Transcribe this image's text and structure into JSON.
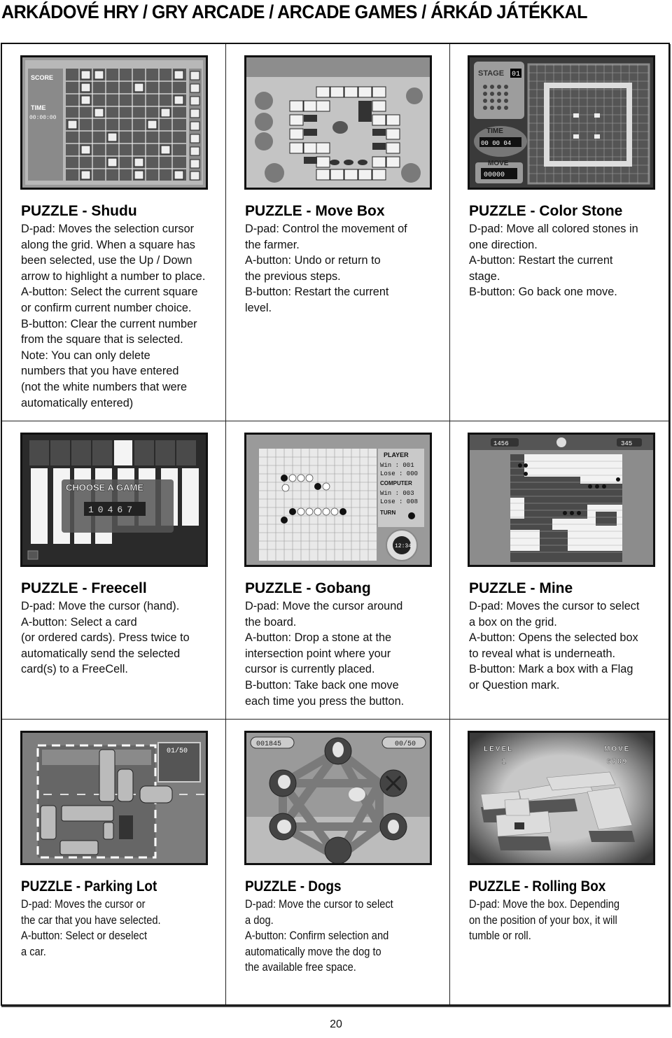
{
  "page": {
    "title": "ARKÁDOVÉ HRY / GRY ARCADE / ARCADE GAMES / ÁRKÁD JÁTÉKKAL",
    "page_number": "20"
  },
  "games": [
    {
      "title": "PUZZLE - Shudu",
      "screenshot_icon": "sudoku-grid-icon",
      "hud": [
        "SCORE",
        "TIME",
        "00:00:00"
      ],
      "lines": [
        "D-pad: Moves the selection cursor",
        "along the grid. When a square has",
        "been selected, use the Up / Down",
        "arrow to highlight a number to place.",
        "A-button: Select the current square",
        "or confirm current number choice.",
        "B-button: Clear the current number",
        "from the square that is selected.",
        "Note: You can only delete",
        "numbers that you have entered",
        "(not the white numbers that were",
        "automatically entered)"
      ]
    },
    {
      "title": "PUZZLE - Move Box",
      "screenshot_icon": "sokoban-board-icon",
      "lines": [
        "D-pad: Control the movement of",
        "the farmer.",
        "A-button: Undo or return to",
        "the previous steps.",
        "B-button: Restart the current",
        "level."
      ]
    },
    {
      "title": "PUZZLE - Color Stone",
      "screenshot_icon": "color-stone-board-icon",
      "hud": [
        "STAGE",
        "01",
        "TIME",
        "00 00 04",
        "MOVE",
        "00000"
      ],
      "lines": [
        "D-pad: Move all colored stones in",
        "one direction.",
        "A-button: Restart the current",
        "stage.",
        "B-button: Go back one move."
      ]
    },
    {
      "title": "PUZZLE - Freecell",
      "screenshot_icon": "freecell-cards-icon",
      "hud": [
        "CHOOSE A GAME",
        "10467"
      ],
      "lines": [
        "D-pad: Move the cursor (hand).",
        "A-button: Select a card",
        "(or ordered cards). Press twice to",
        "automatically send the selected",
        "card(s) to a FreeCell."
      ]
    },
    {
      "title": "PUZZLE - Gobang",
      "screenshot_icon": "gobang-board-icon",
      "hud": [
        "PLAYER",
        "Win : 001",
        "Lose : 000",
        "COMPUTER",
        "Win : 003",
        "Lose : 008",
        "TURN",
        "12:34"
      ],
      "lines": [
        "D-pad: Move the cursor around",
        "the board.",
        "A-button: Drop a stone at the",
        "intersection point where your",
        "cursor is currently placed.",
        "B-button: Take back one move",
        "each time you press the button."
      ]
    },
    {
      "title": "PUZZLE - Mine",
      "screenshot_icon": "minesweeper-grid-icon",
      "hud": [
        "1456",
        "345"
      ],
      "lines": [
        "D-pad: Moves the cursor to select",
        "a box on the grid.",
        "A-button: Opens the selected box",
        "to reveal what is underneath.",
        "B-button: Mark a box with a Flag",
        "or Question mark."
      ]
    },
    {
      "title": "PUZZLE - Parking Lot",
      "screenshot_icon": "parking-lot-icon",
      "hud": [
        "01/50"
      ],
      "lines": [
        "D-pad: Moves the cursor or",
        "the car that you have selected.",
        "A-button: Select or deselect",
        "a car."
      ]
    },
    {
      "title": "PUZZLE - Dogs",
      "screenshot_icon": "dogs-star-board-icon",
      "hud": [
        "001845",
        "00/50"
      ],
      "lines": [
        "D-pad: Move the cursor to select",
        "a dog.",
        "A-button: Confirm selection and",
        "automatically move the dog to",
        "the available free space."
      ]
    },
    {
      "title": "PUZZLE - Rolling Box",
      "screenshot_icon": "rolling-box-board-icon",
      "hud": [
        "LEVEL",
        "1",
        "MOVE",
        "6789"
      ],
      "lines": [
        "D-pad: Move the box. Depending",
        "on the position of your box, it will",
        "tumble or roll."
      ]
    }
  ]
}
